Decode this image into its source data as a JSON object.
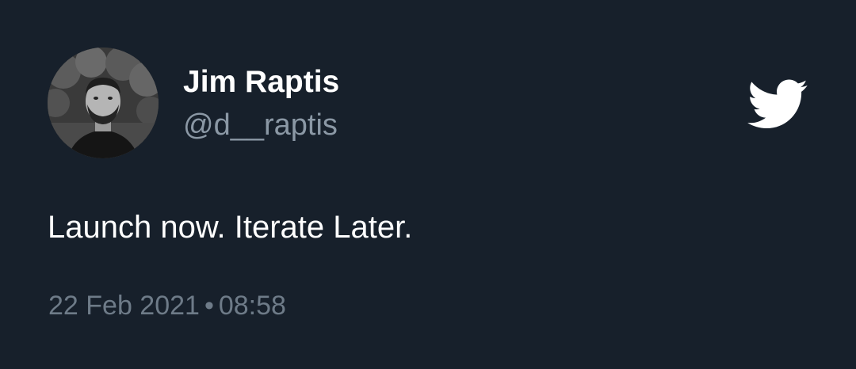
{
  "tweet": {
    "author": {
      "display_name": "Jim Raptis",
      "handle": "@d__raptis",
      "avatar_icon": "profile-photo"
    },
    "text": "Launch now. Iterate Later.",
    "date": "22 Feb 2021",
    "separator": "•",
    "time": "08:58"
  },
  "brand": {
    "icon": "twitter-bird-icon",
    "color": "#ffffff"
  },
  "colors": {
    "background": "#17202b",
    "primary_text": "#ffffff",
    "secondary_text": "#8b98a5",
    "meta_text": "#6e7b88"
  }
}
